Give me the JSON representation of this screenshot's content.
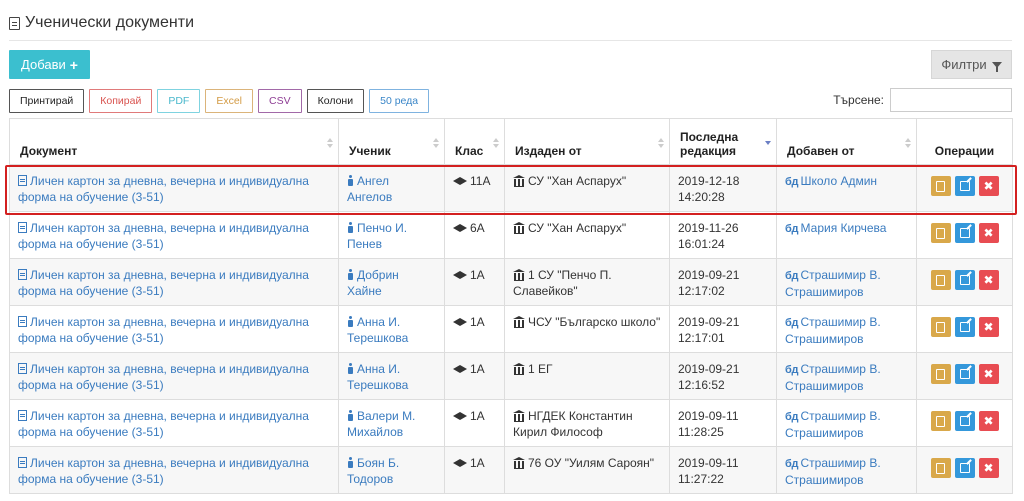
{
  "page": {
    "title": "Ученически документи"
  },
  "toolbar": {
    "add_label": "Добави",
    "filter_label": "Филтри"
  },
  "export_buttons": [
    "Принтирай",
    "Копирай",
    "PDF",
    "Excel",
    "CSV",
    "Колони",
    "50 реда"
  ],
  "search": {
    "label": "Търсене:",
    "value": ""
  },
  "columns": [
    "Документ",
    "Ученик",
    "Клас",
    "Издаден от",
    "Последна редакция",
    "Добавен от",
    "Операции"
  ],
  "sort": {
    "column": "Последна редакция",
    "direction": "desc"
  },
  "rows": [
    {
      "document": "Личен картон за дневна, вечерна и индивидуална форма на обучение (3-51)",
      "student": "Ангел Ангелов",
      "class": "11А",
      "issued_by": "СУ \"Хан Аспарух\"",
      "edited_date": "2019-12-18",
      "edited_time": "14:20:28",
      "added_by": "Школо Админ",
      "highlighted": true
    },
    {
      "document": "Личен картон за дневна, вечерна и индивидуална форма на обучение (3-51)",
      "student": "Пенчо И. Пенев",
      "class": "6А",
      "issued_by": "СУ \"Хан Аспарух\"",
      "edited_date": "2019-11-26",
      "edited_time": "16:01:24",
      "added_by": "Мария Кирчева"
    },
    {
      "document": "Личен картон за дневна, вечерна и индивидуална форма на обучение (3-51)",
      "student": "Добрин Хайне",
      "class": "1А",
      "issued_by": "1 СУ \"Пенчо П. Славейков\"",
      "edited_date": "2019-09-21",
      "edited_time": "12:17:02",
      "added_by": "Страшимир В. Страшимиров"
    },
    {
      "document": "Личен картон за дневна, вечерна и индивидуална форма на обучение (3-51)",
      "student": "Анна И. Терешкова",
      "class": "1А",
      "issued_by": "ЧСУ \"Българско школо\"",
      "edited_date": "2019-09-21",
      "edited_time": "12:17:01",
      "added_by": "Страшимир В. Страшимиров"
    },
    {
      "document": "Личен картон за дневна, вечерна и индивидуална форма на обучение (3-51)",
      "student": "Анна И. Терешкова",
      "class": "1А",
      "issued_by": "1 ЕГ",
      "edited_date": "2019-09-21",
      "edited_time": "12:16:52",
      "added_by": "Страшимир В. Страшимиров"
    },
    {
      "document": "Личен картон за дневна, вечерна и индивидуална форма на обучение (3-51)",
      "student": "Валери М. Михайлов",
      "class": "1А",
      "issued_by": "НГДЕК Константин Кирил Философ",
      "edited_date": "2019-09-11",
      "edited_time": "11:28:25",
      "added_by": "Страшимир В. Страшимиров"
    },
    {
      "document": "Личен картон за дневна, вечерна и индивидуална форма на обучение (3-51)",
      "student": "Боян Б. Тодоров",
      "class": "1А",
      "issued_by": "76 ОУ \"Уилям Сароян\"",
      "edited_date": "2019-09-11",
      "edited_time": "11:27:22",
      "added_by": "Страшимир В. Страшимиров"
    }
  ],
  "row_actions": {
    "pdf_icon": "file-pdf-icon",
    "edit_icon": "edit-icon",
    "delete_icon": "delete-x-icon",
    "delete_glyph": "✖"
  },
  "colors": {
    "accent": "#3bbfcf",
    "link": "#3a7bbf",
    "pdf": "#d9a84a",
    "edit": "#3498db",
    "delete": "#e84c52",
    "highlight": "#d32020"
  }
}
